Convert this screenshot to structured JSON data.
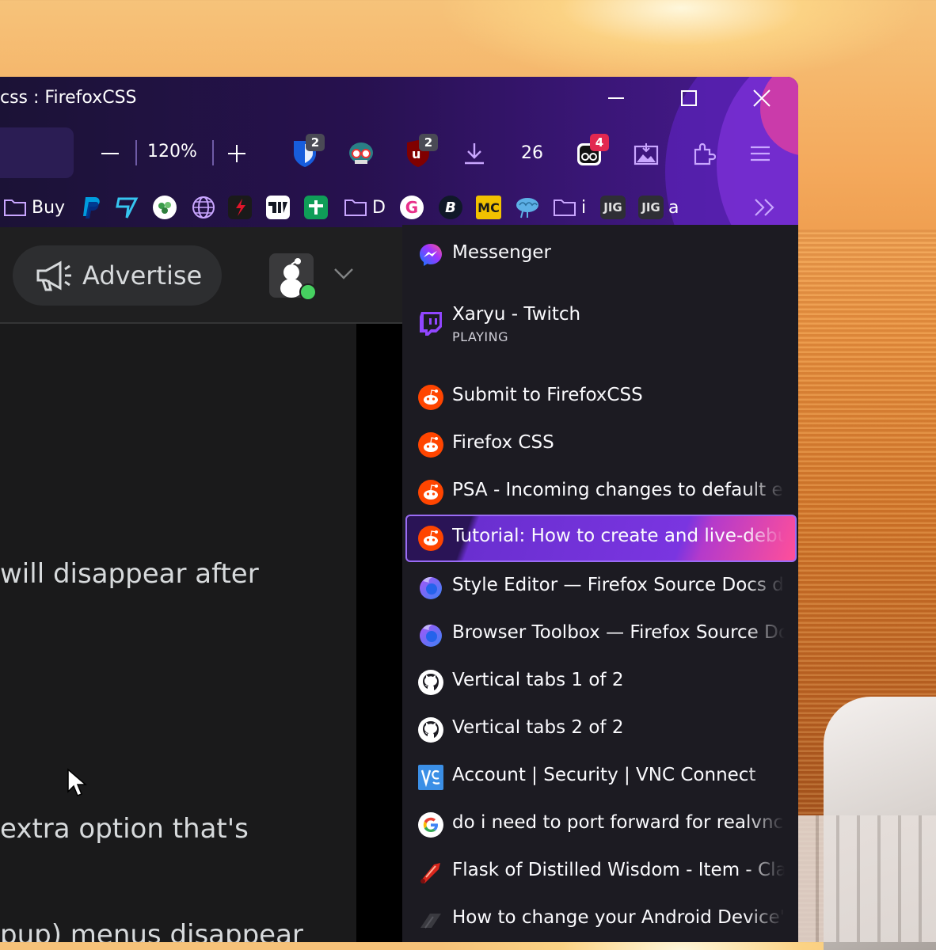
{
  "window": {
    "title": "css : FirefoxCSS",
    "controls": [
      "minimize",
      "maximize",
      "close"
    ]
  },
  "toolbar": {
    "zoom_level": "120%",
    "extensions": [
      {
        "name": "bitwarden",
        "badge": "2"
      },
      {
        "name": "glasses-extension",
        "badge": ""
      },
      {
        "name": "ublock-origin",
        "badge": "2"
      },
      {
        "name": "downloads",
        "badge": ""
      },
      {
        "name": "counter",
        "label": "26"
      },
      {
        "name": "notifier",
        "badge": "4"
      },
      {
        "name": "screenshot",
        "badge": ""
      },
      {
        "name": "extensions",
        "badge": ""
      },
      {
        "name": "menu",
        "badge": ""
      }
    ],
    "counter_label": "26"
  },
  "bookmarks": [
    {
      "type": "folder",
      "label": "Buy"
    },
    {
      "type": "site",
      "icon": "paypal-icon"
    },
    {
      "type": "site",
      "icon": "wise-icon"
    },
    {
      "type": "site",
      "icon": "tree-icon"
    },
    {
      "type": "site",
      "icon": "globe-icon"
    },
    {
      "type": "site",
      "icon": "red-app-icon"
    },
    {
      "type": "site",
      "icon": "tradingview-icon"
    },
    {
      "type": "site",
      "icon": "green-plus-icon"
    },
    {
      "type": "folder",
      "label": "D"
    },
    {
      "type": "site",
      "icon": "g-pink-icon",
      "glyph": "G"
    },
    {
      "type": "site",
      "icon": "b-blue-icon",
      "glyph": "B"
    },
    {
      "type": "site",
      "icon": "mc-icon",
      "glyph": "MC"
    },
    {
      "type": "site",
      "icon": "brain-icon"
    },
    {
      "type": "folder",
      "label": "i"
    },
    {
      "type": "site",
      "icon": "jig-icon",
      "glyph": "JIG"
    },
    {
      "type": "site",
      "icon": "jig-icon",
      "glyph": "JIG",
      "label": "a"
    }
  ],
  "page": {
    "advertise_label": "Advertise",
    "lines": [
      "will disappear after",
      "extra option that's",
      "pup) menus disappear"
    ]
  },
  "tabs": [
    {
      "title": "Messenger",
      "icon": "messenger-icon",
      "sub": ""
    },
    {
      "title": "Xaryu - Twitch",
      "icon": "twitch-icon",
      "sub": "PLAYING"
    },
    {
      "title": "Submit to FirefoxCSS",
      "icon": "reddit-icon",
      "sub": ""
    },
    {
      "title": "Firefox CSS",
      "icon": "reddit-icon",
      "sub": ""
    },
    {
      "title": "PSA - Incoming changes to default elements",
      "icon": "reddit-icon",
      "sub": ""
    },
    {
      "title": "Tutorial: How to create and live-debug",
      "icon": "reddit-icon",
      "sub": "",
      "selected": true
    },
    {
      "title": "Style Editor — Firefox Source Docs documentation",
      "icon": "firefox-icon",
      "sub": ""
    },
    {
      "title": "Browser Toolbox — Firefox Source Docs",
      "icon": "firefox-icon",
      "sub": ""
    },
    {
      "title": "Vertical tabs 1 of 2",
      "icon": "github-icon",
      "sub": ""
    },
    {
      "title": "Vertical tabs 2 of 2",
      "icon": "github-icon",
      "sub": ""
    },
    {
      "title": "Account | Security | VNC Connect",
      "icon": "vnc-icon",
      "sub": ""
    },
    {
      "title": "do i need to port forward for realvnc cloud",
      "icon": "google-icon",
      "sub": ""
    },
    {
      "title": "Flask of Distilled Wisdom - Item - Classic",
      "icon": "flask-icon",
      "sub": ""
    },
    {
      "title": "How to change your Android Device's name",
      "icon": "android-icon",
      "sub": ""
    }
  ],
  "colors": {
    "accent": "#7a35e0",
    "selected_border": "#9a6cf5",
    "reddit": "#ff4500",
    "badge_red": "#e22850"
  }
}
